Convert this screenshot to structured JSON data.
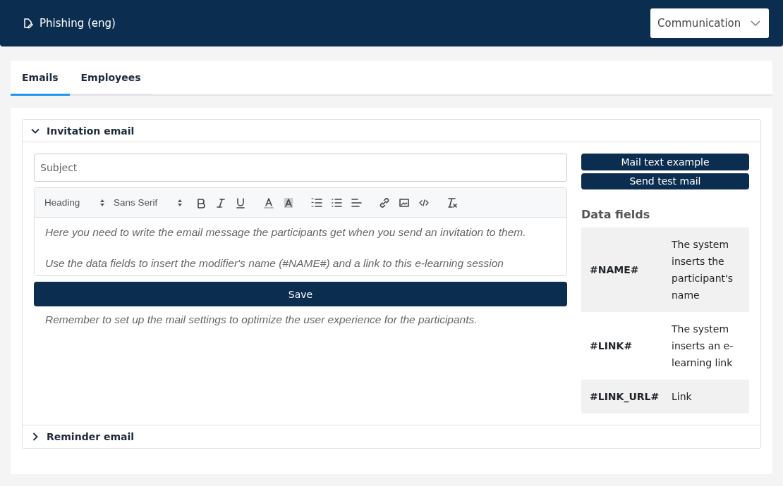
{
  "header": {
    "title": "Phishing (eng)",
    "dropdown": {
      "value": "Communication"
    }
  },
  "tabs": [
    {
      "label": "Emails",
      "selected": true
    },
    {
      "label": "Employees",
      "selected": false
    }
  ],
  "sections": [
    {
      "title": "Invitation email",
      "expanded": true
    },
    {
      "title": "Reminder email",
      "expanded": false
    }
  ],
  "subject": {
    "placeholder": "Subject"
  },
  "editor": {
    "selects": [
      "Heading",
      "Sans Serif"
    ],
    "tools": [
      {
        "kind": "bold"
      },
      {
        "kind": "italic"
      },
      {
        "kind": "underline"
      },
      {
        "kind": "color"
      },
      {
        "kind": "background"
      },
      {
        "kind": "ordered-list"
      },
      {
        "kind": "bullet-list"
      },
      {
        "kind": "align"
      },
      {
        "kind": "link"
      },
      {
        "kind": "image"
      },
      {
        "kind": "code"
      },
      {
        "kind": "clean"
      }
    ],
    "placeholder_paragraphs": [
      "Here you need to write the email message the participants get when you send an invitation to them.",
      "Use the data fields to insert the modifier's name (#NAME#) and a link to this e-learning session"
    ]
  },
  "save_button": "Save",
  "note": "Remember to set up the mail settings to optimize the user experience for the participants.",
  "side_buttons": [
    "Mail text example",
    "Send test mail"
  ],
  "data_fields": {
    "title": "Data fields",
    "rows": [
      {
        "field": "#NAME#",
        "description": "The system inserts the participant's name"
      },
      {
        "field": "#LINK#",
        "description": "The system inserts an e-learning link"
      },
      {
        "field": "#LINK_URL#",
        "description": "Link"
      }
    ]
  }
}
